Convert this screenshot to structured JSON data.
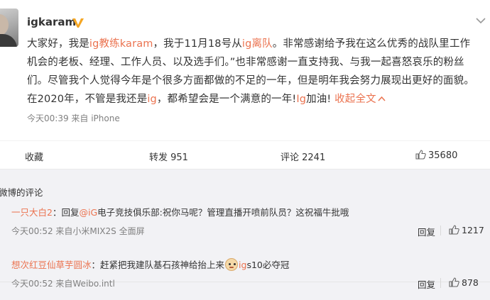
{
  "post": {
    "username": "igkaram",
    "badge": "V",
    "body_segments": [
      {
        "text": "大家好，我是",
        "hl": false
      },
      {
        "text": "ig",
        "hl": true
      },
      {
        "text": "教练karam",
        "hl": true
      },
      {
        "text": "，我于11月18号从",
        "hl": false
      },
      {
        "text": "ig",
        "hl": true
      },
      {
        "text": "离队",
        "hl": true
      },
      {
        "text": "。非常感谢给予我在这么优秀的战队里工作机会的老板、经理、工作人员、以及选手们。”也非常感谢一直支持我、与我一起喜怒哀乐的粉丝们。尽管我个人觉得今年是个很多方面都做的不足的一年，但是明年我会努力展现出更好的面貌。在2020年，不管是我还是",
        "hl": false
      },
      {
        "text": "ig",
        "hl": true
      },
      {
        "text": "，都希望会是一个满意的一年!",
        "hl": false
      },
      {
        "text": "Ig",
        "hl": true
      },
      {
        "text": "加油! ",
        "hl": false
      }
    ],
    "collapse_label": "收起全文",
    "meta": "今天00:39  来自 iPhone"
  },
  "actions": {
    "favorite": "收藏",
    "forward": "转发 951",
    "comment": "评论 2241",
    "like": "35680"
  },
  "comments_section": {
    "title": "微博的评论",
    "items": [
      {
        "user": "一只大白2",
        "text_before": "：回复",
        "mention": "@iG",
        "text_after": "电子竞技俱乐部:祝你马呢？管理直播开喷前队员？这祝福牛批哦",
        "meta": "今天00:52  来自小米MIX2S 全面屏",
        "reply": "回复",
        "likes": "1217"
      },
      {
        "user": "想次红豆仙草芋圆冰",
        "text_before": "：赶紧把我建队基石孩神给抬上来",
        "mention": "ig",
        "text_after": "s10必夺冠",
        "meta": "今天00:52  来自Weibo.intl",
        "reply": "回复",
        "likes": "878"
      }
    ]
  },
  "colors": {
    "accent": "#eb7350",
    "badge": "#f5a623",
    "meta_text": "#808080",
    "comments_bg": "#f2f2f5"
  }
}
